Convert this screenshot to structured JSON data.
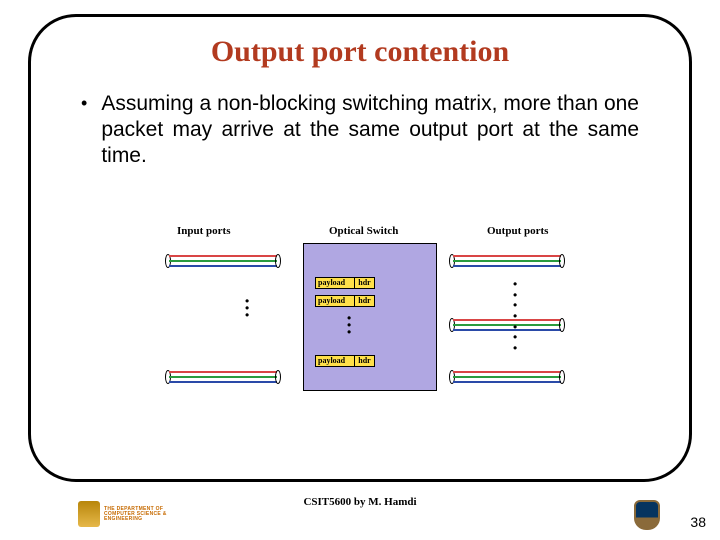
{
  "title": "Output port contention",
  "bullet": "Assuming a non-blocking switching matrix, more than one packet may arrive at the same output port at the same time.",
  "diagram": {
    "input_label": "Input ports",
    "switch_label": "Optical Switch",
    "output_label": "Output ports",
    "payload_label": "payload",
    "hdr_label": "hdr"
  },
  "footer": {
    "dept1": "THE DEPARTMENT OF",
    "dept2": "COMPUTER SCIENCE &",
    "dept3": "ENGINEERING",
    "course": "CSIT5600 by M. Hamdi",
    "page": "38"
  }
}
